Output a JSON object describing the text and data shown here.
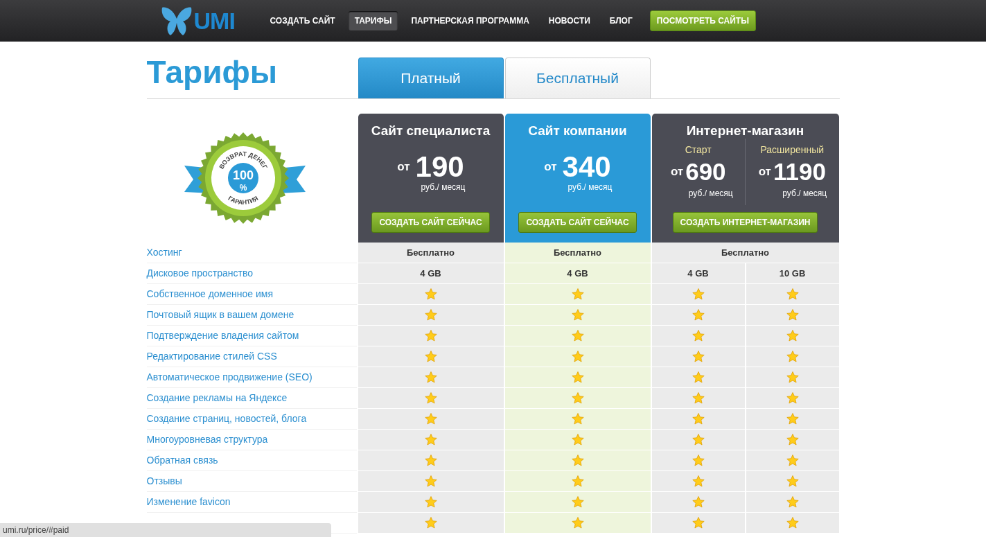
{
  "header": {
    "logo": "UMI",
    "nav": [
      {
        "label": "СОЗДАТЬ САЙТ",
        "kind": "link",
        "selected": false
      },
      {
        "label": "ТАРИФЫ",
        "kind": "link",
        "selected": true
      },
      {
        "label": "ПАРТНЕРСКАЯ ПРОГРАММА",
        "kind": "link",
        "selected": false
      },
      {
        "label": "НОВОСТИ",
        "kind": "link",
        "selected": false
      },
      {
        "label": "БЛОГ",
        "kind": "link",
        "selected": false
      },
      {
        "label": "ПОСМОТРЕТЬ САЙТЫ",
        "kind": "button",
        "selected": false
      }
    ]
  },
  "page_title": "Тарифы",
  "tabs": [
    {
      "label": "Платный",
      "selected": true
    },
    {
      "label": "Бесплатный",
      "selected": false
    }
  ],
  "badge": {
    "top_text": "ВОЗВРАТ ДЕНЕГ",
    "number": "100",
    "unit": "%",
    "bottom_text": "ГАРАНТИЯ"
  },
  "plans": [
    {
      "title": "Сайт специалиста",
      "highlighted": false,
      "prices": [
        {
          "prefix": "от",
          "amount": "190",
          "unit": "руб./ месяц"
        }
      ],
      "button": "СОЗДАТЬ САЙТ СЕЙЧАС"
    },
    {
      "title": "Сайт компании",
      "highlighted": true,
      "prices": [
        {
          "prefix": "от",
          "amount": "340",
          "unit": "руб./ месяц"
        }
      ],
      "button": "СОЗДАТЬ САЙТ СЕЙЧАС"
    },
    {
      "title": "Интернет-магазин",
      "highlighted": false,
      "prices": [
        {
          "name": "Старт",
          "prefix": "от",
          "amount": "690",
          "unit": "руб./ месяц"
        },
        {
          "name": "Расширенный",
          "prefix": "от",
          "amount": "1190",
          "unit": "руб./ месяц"
        }
      ],
      "button": "СОЗДАТЬ ИНТЕРНЕТ-МАГАЗИН"
    }
  ],
  "features": [
    {
      "label": "Хостинг",
      "cells": [
        {
          "kind": "text",
          "text": "Бесплатно"
        },
        {
          "kind": "text",
          "text": "Бесплатно"
        },
        {
          "kind": "text",
          "text": "Бесплатно"
        }
      ]
    },
    {
      "label": "Дисковое пространство",
      "cells": [
        {
          "kind": "text",
          "text": "4 GB"
        },
        {
          "kind": "text",
          "text": "4 GB"
        },
        {
          "kind": "text",
          "text": "4 GB"
        },
        {
          "kind": "text",
          "text": "10 GB"
        }
      ]
    },
    {
      "label": "Собственное доменное имя",
      "cells": [
        {
          "kind": "star"
        },
        {
          "kind": "star"
        },
        {
          "kind": "star"
        },
        {
          "kind": "star"
        }
      ]
    },
    {
      "label": "Почтовый ящик в вашем домене",
      "cells": [
        {
          "kind": "star"
        },
        {
          "kind": "star"
        },
        {
          "kind": "star"
        },
        {
          "kind": "star"
        }
      ]
    },
    {
      "label": "Подтверждение владения сайтом",
      "cells": [
        {
          "kind": "star"
        },
        {
          "kind": "star"
        },
        {
          "kind": "star"
        },
        {
          "kind": "star"
        }
      ]
    },
    {
      "label": "Редактирование стилей CSS",
      "cells": [
        {
          "kind": "star"
        },
        {
          "kind": "star"
        },
        {
          "kind": "star"
        },
        {
          "kind": "star"
        }
      ]
    },
    {
      "label": "Автоматическое продвижение (SEO)",
      "cells": [
        {
          "kind": "star"
        },
        {
          "kind": "star"
        },
        {
          "kind": "star"
        },
        {
          "kind": "star"
        }
      ]
    },
    {
      "label": "Создание рекламы на Яндексе",
      "cells": [
        {
          "kind": "star"
        },
        {
          "kind": "star"
        },
        {
          "kind": "star"
        },
        {
          "kind": "star"
        }
      ]
    },
    {
      "label": "Создание страниц, новостей, блога",
      "cells": [
        {
          "kind": "star"
        },
        {
          "kind": "star"
        },
        {
          "kind": "star"
        },
        {
          "kind": "star"
        }
      ]
    },
    {
      "label": "Многоуровневая структура",
      "cells": [
        {
          "kind": "star"
        },
        {
          "kind": "star"
        },
        {
          "kind": "star"
        },
        {
          "kind": "star"
        }
      ]
    },
    {
      "label": "Обратная связь",
      "cells": [
        {
          "kind": "star"
        },
        {
          "kind": "star"
        },
        {
          "kind": "star"
        },
        {
          "kind": "star"
        }
      ]
    },
    {
      "label": "Отзывы",
      "cells": [
        {
          "kind": "star"
        },
        {
          "kind": "star"
        },
        {
          "kind": "star"
        },
        {
          "kind": "star"
        }
      ]
    },
    {
      "label": "Изменение favicon",
      "cells": [
        {
          "kind": "star"
        },
        {
          "kind": "star"
        },
        {
          "kind": "star"
        },
        {
          "kind": "star"
        }
      ]
    },
    {
      "cells": [
        {
          "kind": "star"
        },
        {
          "kind": "star"
        },
        {
          "kind": "star"
        },
        {
          "kind": "star"
        }
      ]
    }
  ],
  "status_bar": "umi.ru/price/#paid"
}
